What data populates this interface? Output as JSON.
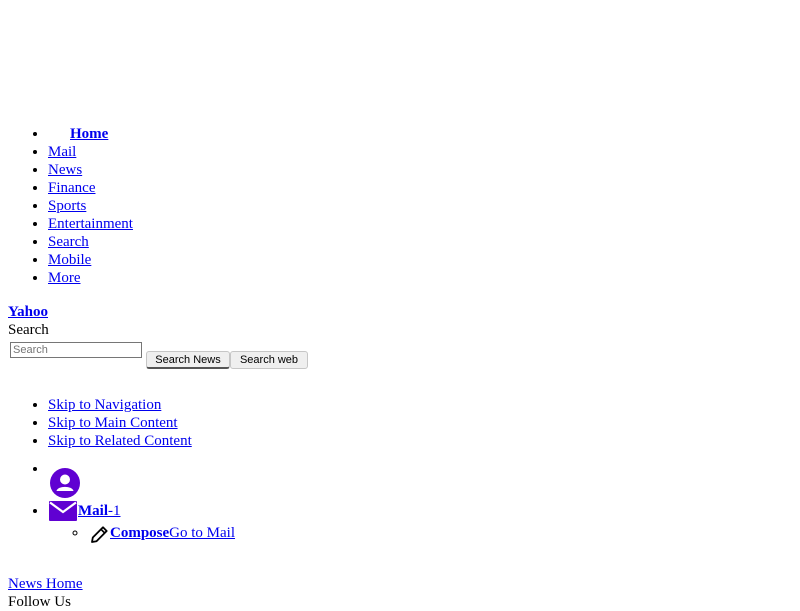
{
  "nav": {
    "items": [
      {
        "label": "Home"
      },
      {
        "label": "Mail"
      },
      {
        "label": "News"
      },
      {
        "label": "Finance"
      },
      {
        "label": "Sports"
      },
      {
        "label": "Entertainment"
      },
      {
        "label": "Search"
      },
      {
        "label": "Mobile"
      },
      {
        "label": "More"
      }
    ]
  },
  "logo": {
    "label": "Yahoo"
  },
  "search": {
    "label": "Search",
    "placeholder": "Search",
    "news_button": "Search News",
    "web_button": "Search web"
  },
  "skip_links": [
    {
      "label": "Skip to Navigation"
    },
    {
      "label": "Skip to Main Content"
    },
    {
      "label": "Skip to Related Content"
    }
  ],
  "user": {
    "mail_label": "Mail",
    "mail_count": "-1",
    "compose_label": "Compose",
    "go_to_mail_label": "Go to Mail"
  },
  "footer": {
    "news_home": "News Home",
    "follow_us": "Follow Us"
  },
  "icons": {
    "profile": "profile-icon",
    "mail": "mail-icon",
    "compose": "pencil-icon"
  },
  "colors": {
    "link": "#0000ee",
    "icon": "#6001d2"
  }
}
